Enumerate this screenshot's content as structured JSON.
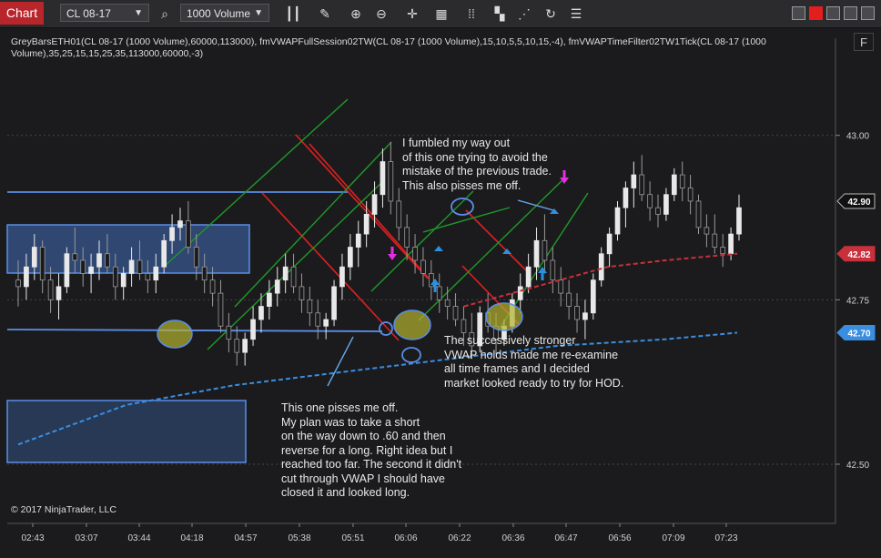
{
  "toolbar": {
    "tab_label": "Chart",
    "instrument": "CL 08-17",
    "bar_type": "1000 Volume"
  },
  "indicator_text": "GreyBarsETH01(CL 08-17 (1000 Volume),60000,113000), fmVWAPFullSession02TW(CL 08-17 (1000 Volume),15,10,5,5,10,15,-4), fmVWAPTimeFilter02TW1Tick(CL 08-17 (1000 Volume),35,25,15,15,25,35,113000,60000,-3)",
  "side_button": "F",
  "copyright": "© 2017 NinjaTrader, LLC",
  "colors": {
    "background": "#1b1b1d",
    "up_bar": "#e8e8e8",
    "down_bar": "#9a9a9a",
    "vwap_full": "#3a8ee0",
    "vwap_filtered": "#c8303c",
    "channel_red": "#e02020",
    "channel_green": "#1f9a2a",
    "zone_fill": "#3a5f9e",
    "zone_border": "#5a8ee6",
    "highlight_circle": "#b3b230",
    "arrow_magenta": "#e030e0",
    "arrow_blue": "#2a90e0",
    "label_current": "#111111",
    "label_red": "#c8303c",
    "label_blue": "#3a8ee0"
  },
  "annotations": [
    "I fumbled my way out\nof this one trying to avoid the\nmistake of the previous trade.\nThis also pisses me off.",
    "The successively stronger\nVWAP holds made me re-examine\nall time frames and I decided\nmarket looked ready to try for HOD.",
    "This one pisses me off.\nMy plan was to take a short\non the way down to .60 and then\nreverse for a long. Right idea but I\nreached too far. The second it didn't\ncut through VWAP I should have\nclosed it and looked long."
  ],
  "chart_data": {
    "type": "candlestick",
    "x_ticks": [
      "02:43",
      "03:07",
      "03:44",
      "04:18",
      "04:57",
      "05:38",
      "05:51",
      "06:06",
      "06:22",
      "06:36",
      "06:47",
      "06:56",
      "07:09",
      "07:23"
    ],
    "y_ticks": [
      "43.00",
      "42.75",
      "42.50"
    ],
    "y_tick_values": [
      43.0,
      42.75,
      42.5
    ],
    "ylim": [
      42.41,
      43.12
    ],
    "price_labels": [
      {
        "value": 42.9,
        "text": "42.90",
        "role": "current"
      },
      {
        "value": 42.82,
        "text": "42.82",
        "role": "vwap-filtered"
      },
      {
        "value": 42.7,
        "text": "42.70",
        "role": "vwap-full"
      }
    ],
    "bars": [
      [
        42.78,
        42.81,
        42.74,
        42.77
      ],
      [
        42.77,
        42.82,
        42.75,
        42.8
      ],
      [
        42.8,
        42.85,
        42.78,
        42.83
      ],
      [
        42.83,
        42.84,
        42.76,
        42.78
      ],
      [
        42.78,
        42.8,
        42.73,
        42.75
      ],
      [
        42.75,
        42.79,
        42.72,
        42.77
      ],
      [
        42.77,
        42.83,
        42.76,
        42.82
      ],
      [
        42.82,
        42.86,
        42.79,
        42.81
      ],
      [
        42.81,
        42.83,
        42.77,
        42.79
      ],
      [
        42.79,
        42.82,
        42.76,
        42.8
      ],
      [
        42.8,
        42.84,
        42.78,
        42.82
      ],
      [
        42.82,
        42.85,
        42.79,
        42.8
      ],
      [
        42.8,
        42.82,
        42.75,
        42.77
      ],
      [
        42.77,
        42.8,
        42.75,
        42.79
      ],
      [
        42.79,
        42.83,
        42.77,
        42.81
      ],
      [
        42.81,
        42.84,
        42.78,
        42.79
      ],
      [
        42.79,
        42.81,
        42.76,
        42.78
      ],
      [
        42.78,
        42.82,
        42.76,
        42.8
      ],
      [
        42.8,
        42.85,
        42.79,
        42.84
      ],
      [
        42.84,
        42.88,
        42.82,
        42.86
      ],
      [
        42.86,
        42.89,
        42.84,
        42.87
      ],
      [
        42.87,
        42.9,
        42.82,
        42.83
      ],
      [
        42.83,
        42.85,
        42.78,
        42.8
      ],
      [
        42.8,
        42.82,
        42.76,
        42.78
      ],
      [
        42.78,
        42.8,
        42.74,
        42.76
      ],
      [
        42.76,
        42.78,
        42.7,
        42.71
      ],
      [
        42.71,
        42.73,
        42.67,
        42.69
      ],
      [
        42.69,
        42.71,
        42.65,
        42.67
      ],
      [
        42.67,
        42.7,
        42.65,
        42.69
      ],
      [
        42.69,
        42.74,
        42.68,
        42.72
      ],
      [
        42.72,
        42.76,
        42.7,
        42.74
      ],
      [
        42.74,
        42.78,
        42.72,
        42.76
      ],
      [
        42.76,
        42.8,
        42.74,
        42.78
      ],
      [
        42.78,
        42.82,
        42.76,
        42.8
      ],
      [
        42.8,
        42.82,
        42.76,
        42.77
      ],
      [
        42.77,
        42.79,
        42.73,
        42.75
      ],
      [
        42.75,
        42.77,
        42.71,
        42.73
      ],
      [
        42.73,
        42.75,
        42.69,
        42.71
      ],
      [
        42.71,
        42.73,
        42.69,
        42.72
      ],
      [
        42.72,
        42.78,
        42.71,
        42.77
      ],
      [
        42.77,
        42.82,
        42.75,
        42.8
      ],
      [
        42.8,
        42.85,
        42.78,
        42.83
      ],
      [
        42.83,
        42.87,
        42.8,
        42.85
      ],
      [
        42.85,
        42.9,
        42.83,
        42.88
      ],
      [
        42.88,
        42.93,
        42.86,
        42.91
      ],
      [
        42.91,
        42.98,
        42.89,
        42.96
      ],
      [
        42.96,
        42.99,
        42.88,
        42.9
      ],
      [
        42.9,
        42.92,
        42.84,
        42.86
      ],
      [
        42.86,
        42.88,
        42.81,
        42.83
      ],
      [
        42.83,
        42.85,
        42.79,
        42.81
      ],
      [
        42.81,
        42.83,
        42.77,
        42.79
      ],
      [
        42.79,
        42.81,
        42.75,
        42.77
      ],
      [
        42.77,
        42.79,
        42.73,
        42.75
      ],
      [
        42.75,
        42.77,
        42.72,
        42.74
      ],
      [
        42.74,
        42.76,
        42.71,
        42.72
      ],
      [
        42.72,
        42.74,
        42.68,
        42.7
      ],
      [
        42.7,
        42.73,
        42.66,
        42.68
      ],
      [
        42.68,
        42.74,
        42.67,
        42.73
      ],
      [
        42.73,
        42.76,
        42.7,
        42.71
      ],
      [
        42.71,
        42.73,
        42.67,
        42.69
      ],
      [
        42.69,
        42.72,
        42.68,
        42.71
      ],
      [
        42.71,
        42.76,
        42.7,
        42.75
      ],
      [
        42.75,
        42.79,
        42.73,
        42.77
      ],
      [
        42.77,
        42.82,
        42.76,
        42.8
      ],
      [
        42.8,
        42.86,
        42.78,
        42.84
      ],
      [
        42.84,
        42.88,
        42.79,
        42.81
      ],
      [
        42.81,
        42.83,
        42.76,
        42.78
      ],
      [
        42.78,
        42.8,
        42.74,
        42.76
      ],
      [
        42.76,
        42.78,
        42.72,
        42.74
      ],
      [
        42.74,
        42.76,
        42.7,
        42.72
      ],
      [
        42.72,
        42.75,
        42.69,
        42.73
      ],
      [
        42.73,
        42.79,
        42.72,
        42.78
      ],
      [
        42.78,
        42.83,
        42.77,
        42.82
      ],
      [
        42.82,
        42.86,
        42.8,
        42.85
      ],
      [
        42.85,
        42.9,
        42.84,
        42.89
      ],
      [
        42.89,
        42.93,
        42.86,
        42.92
      ],
      [
        42.92,
        42.96,
        42.89,
        42.94
      ],
      [
        42.94,
        42.97,
        42.9,
        42.91
      ],
      [
        42.91,
        42.93,
        42.87,
        42.89
      ],
      [
        42.89,
        42.91,
        42.86,
        42.88
      ],
      [
        42.88,
        42.92,
        42.87,
        42.91
      ],
      [
        42.91,
        42.95,
        42.9,
        42.94
      ],
      [
        42.94,
        42.96,
        42.9,
        42.92
      ],
      [
        42.92,
        42.94,
        42.88,
        42.9
      ],
      [
        42.9,
        42.91,
        42.85,
        42.86
      ],
      [
        42.86,
        42.88,
        42.83,
        42.85
      ],
      [
        42.85,
        42.88,
        42.82,
        42.83
      ],
      [
        42.83,
        42.85,
        42.8,
        42.82
      ],
      [
        42.82,
        42.86,
        42.81,
        42.85
      ],
      [
        42.85,
        42.91,
        42.84,
        42.89
      ]
    ],
    "vwap_full": [
      [
        0.0,
        42.53
      ],
      [
        0.15,
        42.59
      ],
      [
        0.3,
        42.62
      ],
      [
        0.45,
        42.64
      ],
      [
        0.6,
        42.66
      ],
      [
        0.75,
        42.68
      ],
      [
        0.9,
        42.69
      ],
      [
        1.0,
        42.7
      ]
    ],
    "vwap_filtered": [
      [
        0.62,
        42.74
      ],
      [
        0.72,
        42.77
      ],
      [
        0.82,
        42.8
      ],
      [
        0.9,
        42.81
      ],
      [
        1.0,
        42.82
      ]
    ]
  }
}
